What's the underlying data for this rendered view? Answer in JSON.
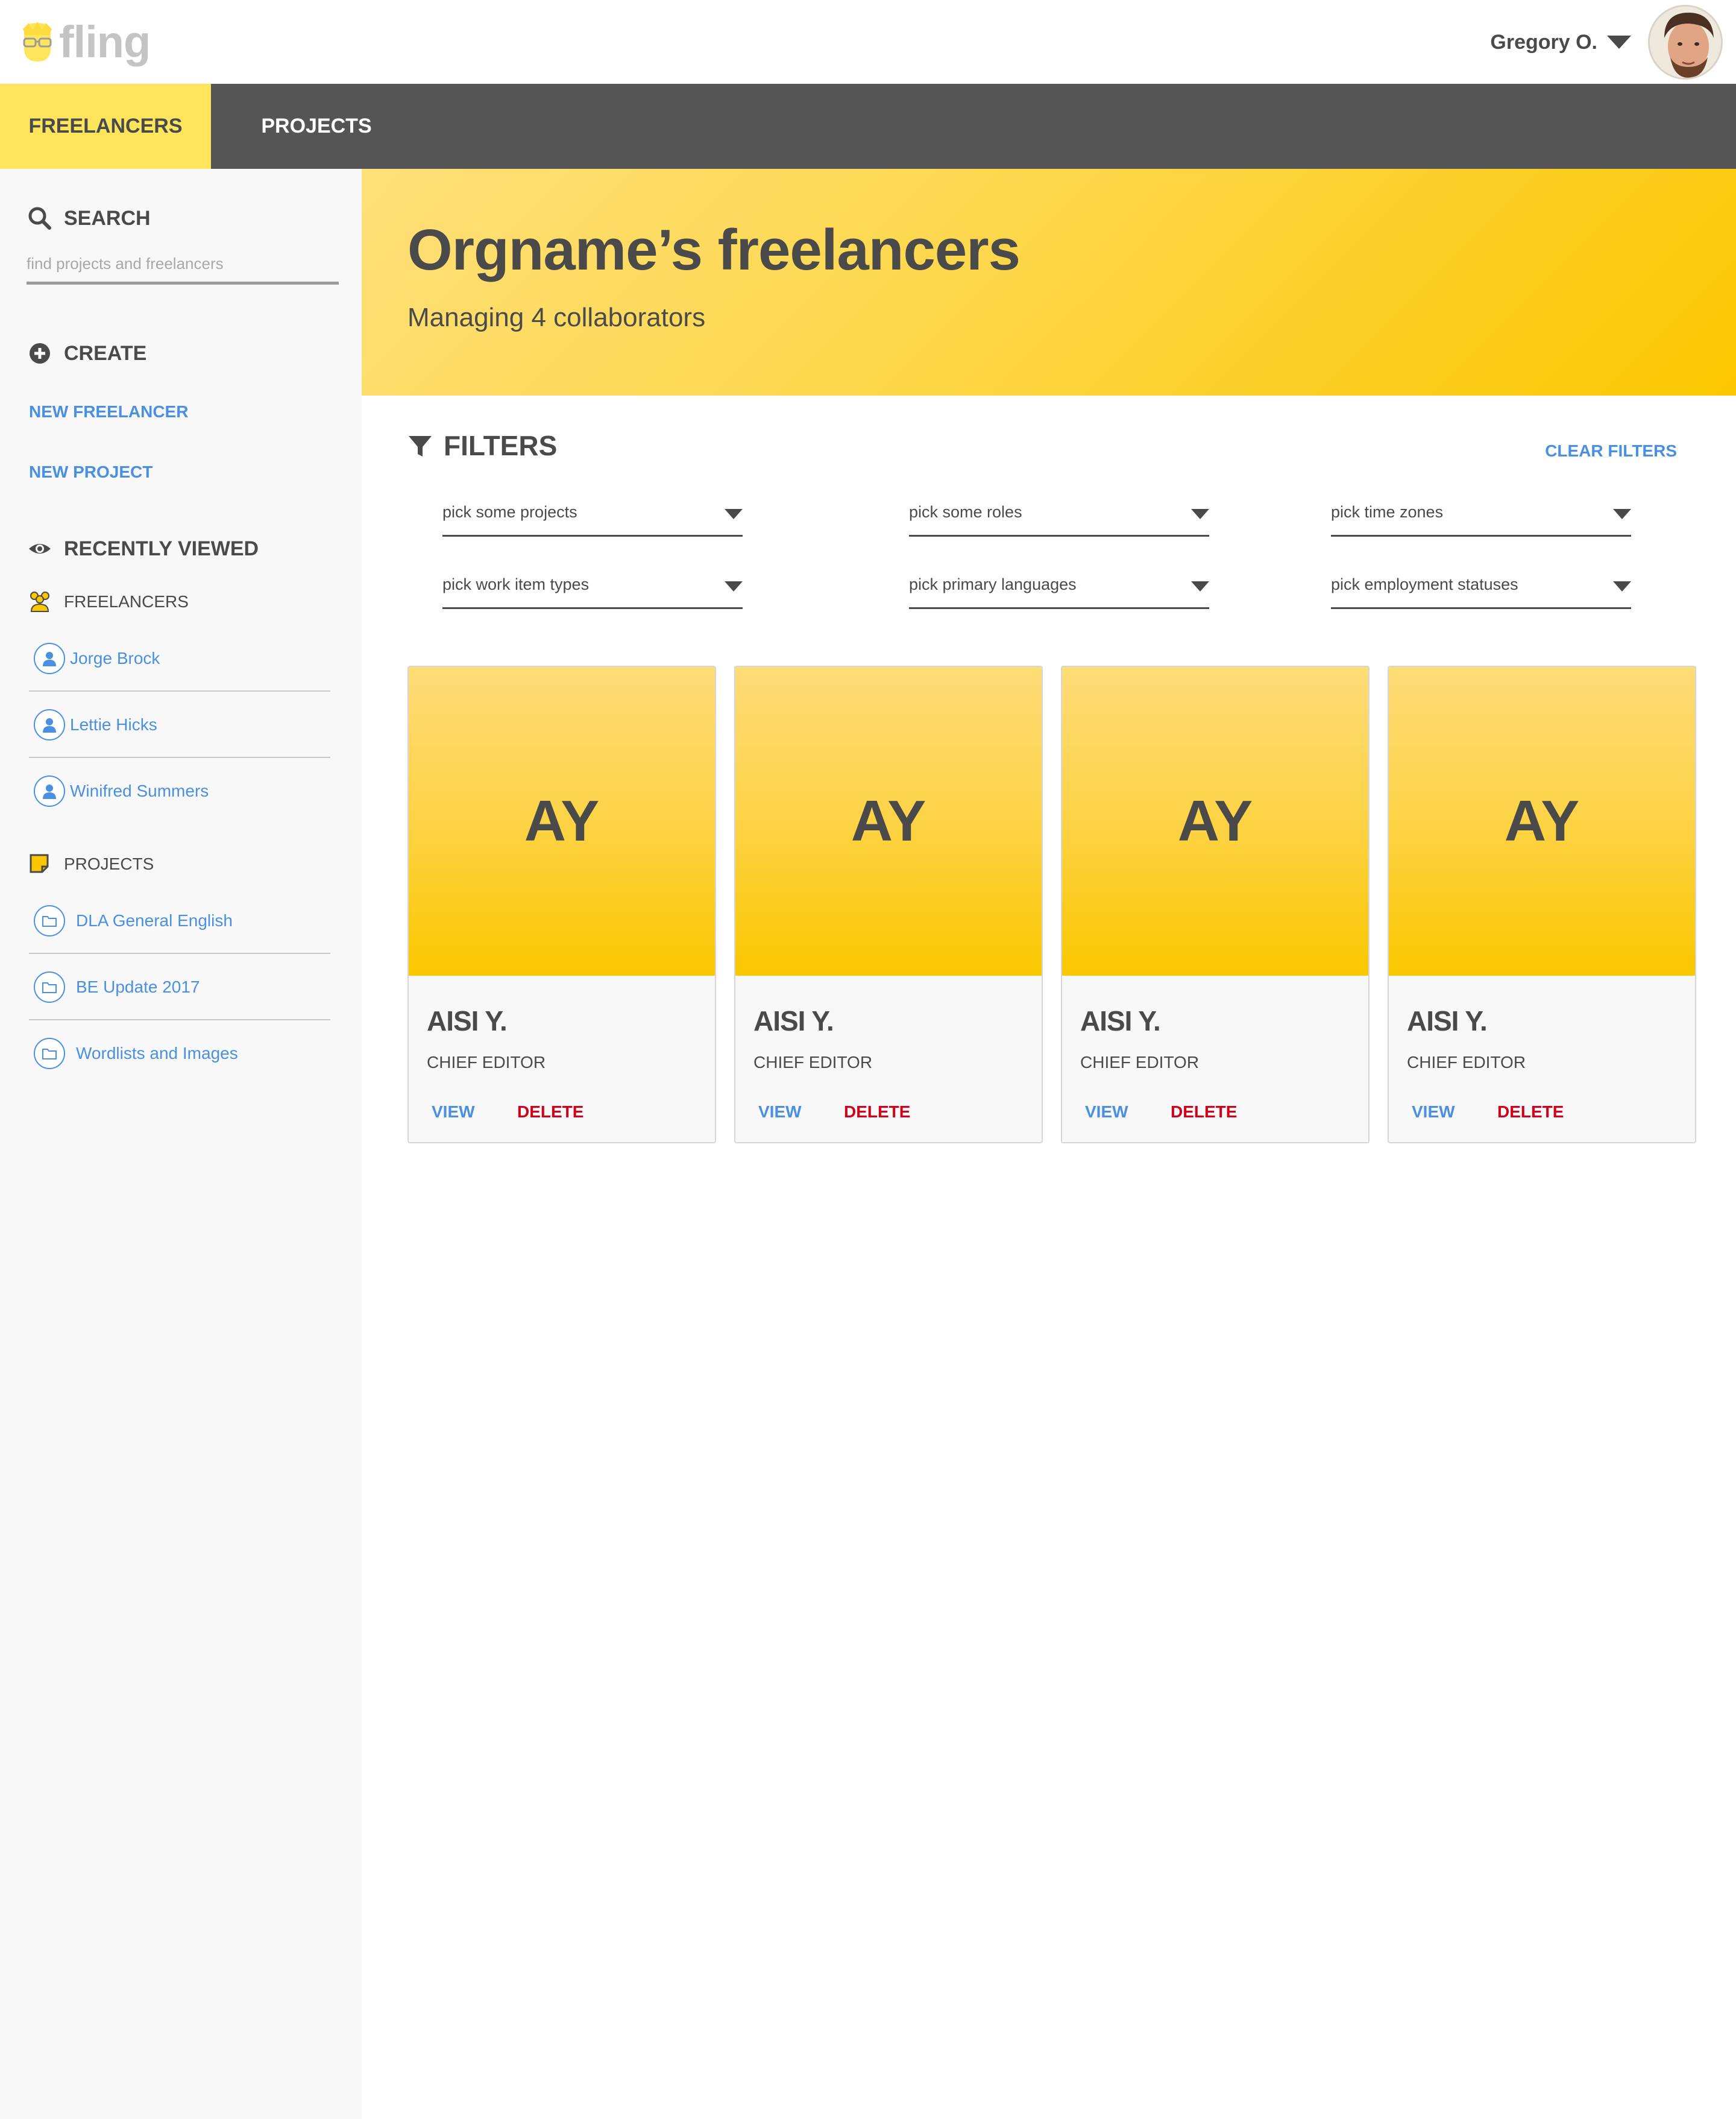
{
  "app": {
    "logo_text": "fling"
  },
  "header": {
    "user_name": "Gregory O."
  },
  "nav": {
    "tabs": [
      {
        "label": "FREELANCERS",
        "active": true
      },
      {
        "label": "PROJECTS",
        "active": false
      }
    ]
  },
  "sidebar": {
    "search": {
      "heading": "SEARCH",
      "placeholder": "find projects and freelancers",
      "value": ""
    },
    "create": {
      "heading": "CREATE",
      "links": [
        "NEW FREELANCER",
        "NEW PROJECT"
      ]
    },
    "recent": {
      "heading": "RECENTLY VIEWED",
      "freelancers": {
        "heading": "FREELANCERS",
        "items": [
          "Jorge Brock",
          "Lettie Hicks",
          "Winifred Summers"
        ]
      },
      "projects": {
        "heading": "PROJECTS",
        "items": [
          "DLA General English",
          "BE Update 2017",
          "Wordlists and Images"
        ]
      }
    }
  },
  "hero": {
    "title": "Orgname’s freelancers",
    "subtitle": "Managing 4 collaborators"
  },
  "filters": {
    "heading": "FILTERS",
    "clear_label": "CLEAR FILTERS",
    "fields": [
      "pick some projects",
      "pick some roles",
      "pick time zones",
      "pick work item types",
      "pick primary languages",
      "pick employment statuses"
    ]
  },
  "cards": [
    {
      "initials": "AY",
      "name": "AISI Y.",
      "role": "CHIEF EDITOR",
      "view": "VIEW",
      "delete": "DELETE"
    },
    {
      "initials": "AY",
      "name": "AISI Y.",
      "role": "CHIEF EDITOR",
      "view": "VIEW",
      "delete": "DELETE"
    },
    {
      "initials": "AY",
      "name": "AISI Y.",
      "role": "CHIEF EDITOR",
      "view": "VIEW",
      "delete": "DELETE"
    },
    {
      "initials": "AY",
      "name": "AISI Y.",
      "role": "CHIEF EDITOR",
      "view": "VIEW",
      "delete": "DELETE"
    }
  ],
  "colors": {
    "accent_yellow": "#fee55b",
    "nav_bg": "#555555",
    "link_blue": "#4a90e2",
    "delete_red": "#d0021b",
    "text_dark": "#4a4a4a"
  }
}
